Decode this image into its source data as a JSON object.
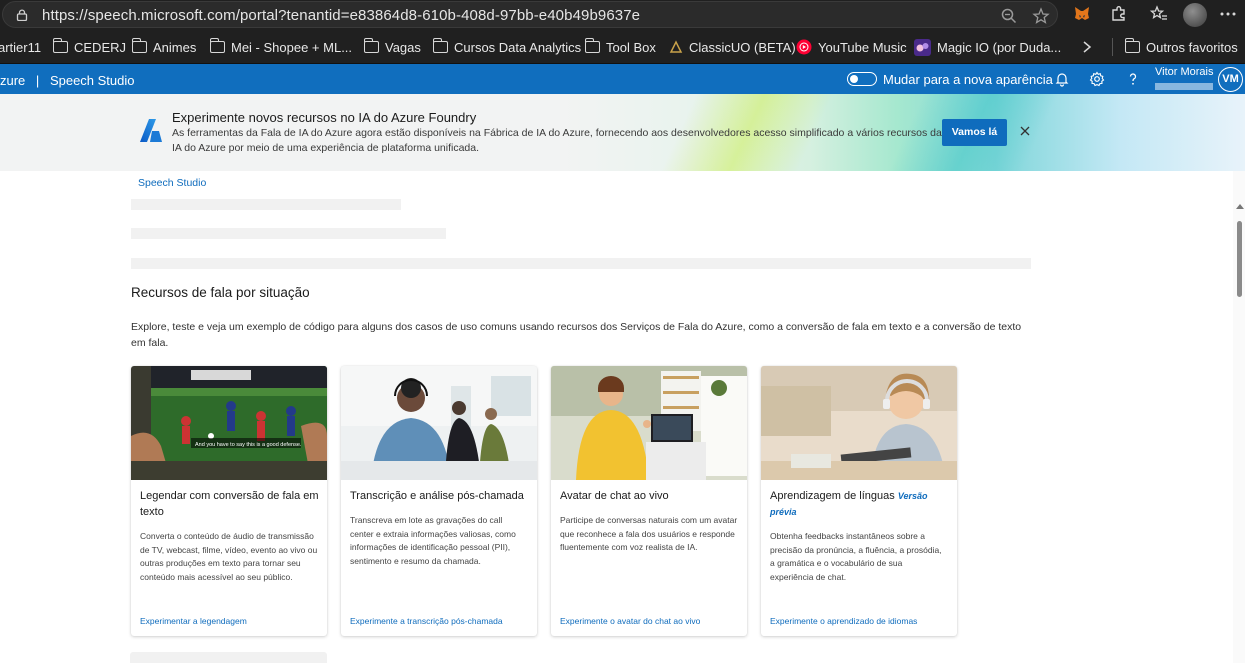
{
  "browser": {
    "url": "https://speech.microsoft.com/portal?tenantid=e83864d8-610b-408d-97bb-e40b49b9637e",
    "bookmarks": [
      {
        "label": "artier11",
        "type": "text"
      },
      {
        "label": "CEDERJ",
        "type": "folder"
      },
      {
        "label": "Animes",
        "type": "folder"
      },
      {
        "label": "Mei - Shopee + ML...",
        "type": "folder"
      },
      {
        "label": "Vagas",
        "type": "folder"
      },
      {
        "label": "Cursos Data Analytics",
        "type": "folder"
      },
      {
        "label": "Tool Box",
        "type": "folder"
      },
      {
        "label": "ClassicUO (BETA)",
        "type": "site"
      },
      {
        "label": "YouTube Music",
        "type": "site"
      },
      {
        "label": "Magic IO (por Duda...",
        "type": "site"
      }
    ],
    "other_favorites": "Outros favoritos"
  },
  "header": {
    "brand": "zure",
    "separator": "|",
    "app": "Speech Studio",
    "toggle_label": "Mudar para a nova aparência",
    "user_name": "Vitor Morais",
    "avatar_initials": "VM",
    "brand_color": "#106ebe"
  },
  "banner": {
    "title": "Experimente novos recursos no IA do Azure Foundry",
    "description": "As ferramentas da Fala de IA do Azure agora estão disponíveis na Fábrica de IA do Azure, fornecendo aos desenvolvedores acesso simplificado a vários recursos da IA do Azure por meio de uma experiência de plataforma unificada.",
    "button": "Vamos lá"
  },
  "breadcrumb": "Speech Studio",
  "section": {
    "title": "Recursos de fala por situação",
    "description": "Explore, teste e veja um exemplo de código para alguns dos casos de uso comuns usando recursos dos Serviços de Fala do Azure, como a conversão de fala em texto e a conversão de texto em fala."
  },
  "cards": [
    {
      "title": "Legendar com conversão de fala em texto",
      "badge": "",
      "description": "Converta o conteúdo de áudio de transmissão de TV, webcast, filme, vídeo, evento ao vivo ou outras produções em texto para tornar seu conteúdo mais acessível ao seu público.",
      "link": "Experimentar a legendagem",
      "image_caption": "And you have to say this is a good defense."
    },
    {
      "title": "Transcrição e análise pós-chamada",
      "badge": "",
      "description": "Transcreva em lote as gravações do call center e extraia informações valiosas, como informações de identificação pessoal (PII), sentimento e resumo da chamada.",
      "link": "Experimente a transcrição pós-chamada"
    },
    {
      "title": "Avatar de chat ao vivo",
      "badge": "",
      "description": "Participe de conversas naturais com um avatar que reconhece a fala dos usuários e responde fluentemente com voz realista de IA.",
      "link": "Experimente o avatar do chat ao vivo"
    },
    {
      "title": "Aprendizagem de línguas",
      "badge": "Versão prévia",
      "description": "Obtenha feedbacks instantâneos sobre a precisão da pronúncia, a fluência, a prosódia, a gramática e o vocabulário de sua experiência de chat.",
      "link": "Experimente o aprendizado de idiomas"
    }
  ]
}
